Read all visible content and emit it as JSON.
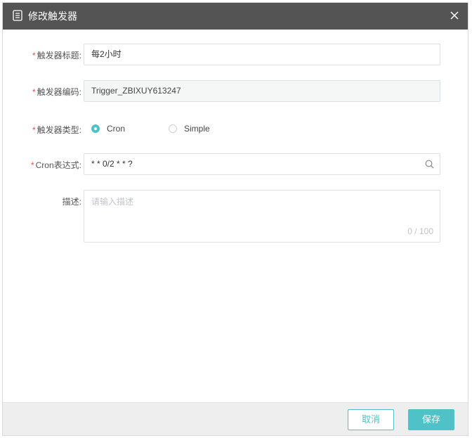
{
  "dialog": {
    "title": "修改触发器",
    "colors": {
      "header_bg": "#545454",
      "accent": "#4ec2c6",
      "required": "#e84d4d"
    }
  },
  "form": {
    "title_field": {
      "required_mark": "*",
      "label": "触发器标题:",
      "value": "每2小时"
    },
    "code_field": {
      "required_mark": "*",
      "label": "触发器编码:",
      "value": "Trigger_ZBIXUY613247"
    },
    "type_field": {
      "required_mark": "*",
      "label": "触发器类型:",
      "options": [
        {
          "label": "Cron",
          "checked": true
        },
        {
          "label": "Simple",
          "checked": false
        }
      ]
    },
    "cron_field": {
      "required_mark": "*",
      "label": "Cron表达式:",
      "value": "* * 0/2 * * ?",
      "icon": "search-icon"
    },
    "desc_field": {
      "label": "描述:",
      "placeholder": "请输入描述",
      "counter": "0 / 100"
    }
  },
  "footer": {
    "cancel_label": "取消",
    "save_label": "保存"
  }
}
